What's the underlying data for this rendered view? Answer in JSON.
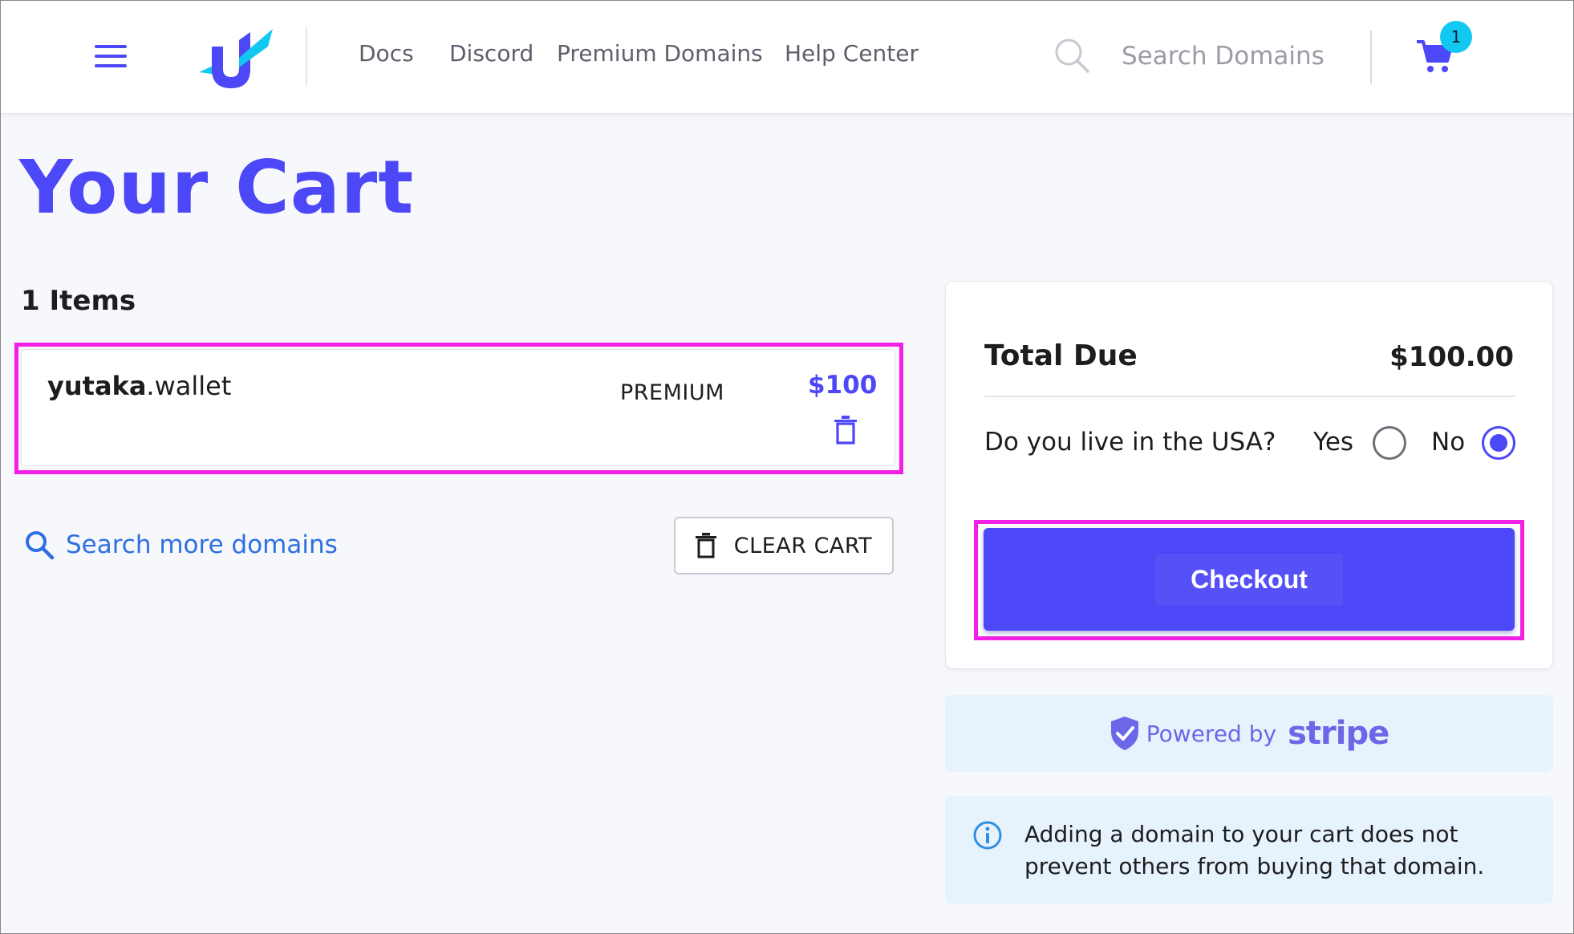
{
  "header": {
    "nav": [
      "Docs",
      "Discord",
      "Premium Domains",
      "Help Center"
    ],
    "search_placeholder": "Search Domains",
    "cart_count": "1"
  },
  "page": {
    "title": "Your Cart",
    "items_count": "1 Items"
  },
  "cart_item": {
    "name_bold": "yutaka",
    "name_tld": ".wallet",
    "tier": "PREMIUM",
    "price": "$100"
  },
  "actions": {
    "search_more": "Search more domains",
    "clear_cart": "CLEAR CART"
  },
  "summary": {
    "total_label": "Total Due",
    "total_value": "$100.00",
    "usa_question": "Do you live in the USA?",
    "yes_label": "Yes",
    "no_label": "No",
    "usa_selected": "No",
    "checkout_label": "Checkout"
  },
  "stripe": {
    "powered_by": "Powered by",
    "brand": "stripe"
  },
  "info": {
    "text": "Adding a domain to your cart does not prevent others from buying that domain."
  },
  "colors": {
    "accent": "#4c47f7",
    "highlight": "#f21fe6",
    "link": "#2f6fe0",
    "badge": "#12c8f0"
  }
}
